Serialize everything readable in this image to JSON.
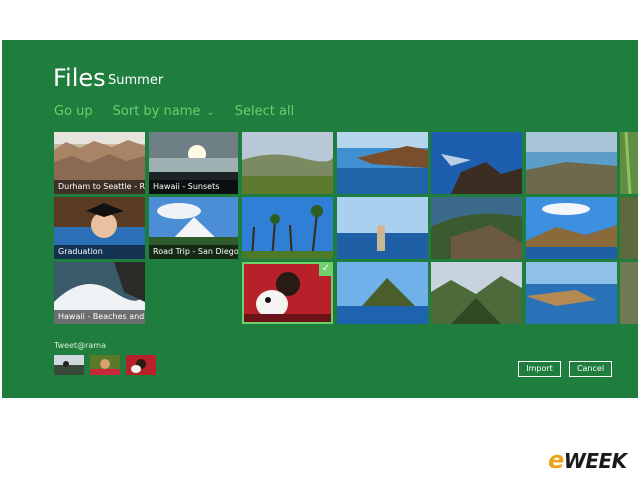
{
  "app": {
    "title": "Files",
    "subtitle": "Summer"
  },
  "toolbar": {
    "go_up": "Go up",
    "sort_by": "Sort by name",
    "select_all": "Select all"
  },
  "tiles": [
    {
      "caption": "Durham to Seattle - Road..."
    },
    {
      "caption": "Hawaii - Sunsets"
    },
    {
      "caption": "Graduation"
    },
    {
      "caption": "Road Trip - San Diego to ..."
    },
    {
      "caption": "Hawaii - Beaches and Wa..."
    }
  ],
  "tweet": {
    "label": "Tweet@rama"
  },
  "actions": {
    "import": "Import",
    "cancel": "Cancel"
  },
  "colors": {
    "background": "#1f7d3e",
    "accent": "#6fcf6a"
  },
  "icons": {
    "sort": "chevron-down-icon",
    "selected": "checkmark-icon"
  },
  "watermark": "eWEEK"
}
